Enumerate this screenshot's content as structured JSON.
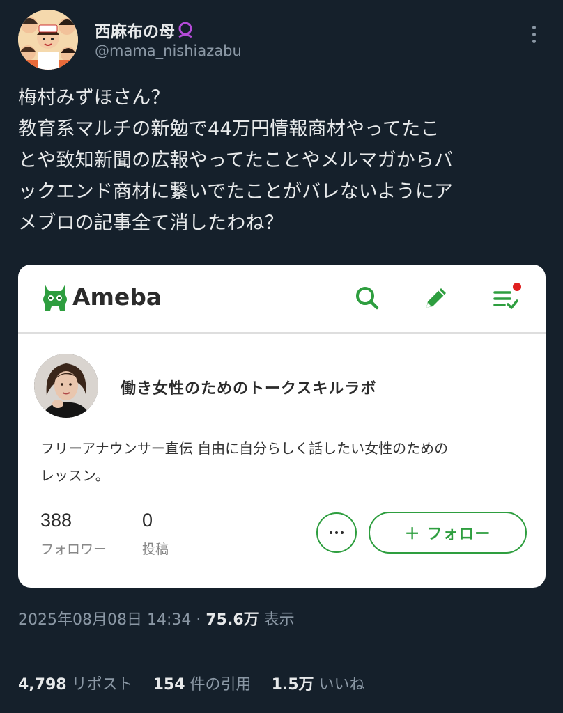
{
  "author": {
    "display_name": "西麻布の母",
    "handle": "@mama_nishiazabu",
    "badge_icon": "purple-ring-badge-icon",
    "badge_color": "#b44bd8"
  },
  "tweet": {
    "lines": [
      "梅村みずほさん？",
      "教育系マルチの新勉で44万円情報商材やってたこ",
      "とや致知新聞の広報やってたことやメルマガからバ",
      "ックエンド商材に繋いでたことがバレないようにア",
      "メブロの記事全て消したわね？"
    ]
  },
  "card": {
    "brand": "Ameba",
    "brand_color": "#2e9e3f",
    "header_icons": [
      "search-icon",
      "pencil-icon",
      "notification-list-icon"
    ],
    "blog_title": "働き女性のためのトークスキルラボ",
    "description_lines": [
      "フリーアナウンサー直伝 自由に自分らしく話したい女性のための",
      "レッスン。"
    ],
    "followers_count": "388",
    "followers_label": "フォロワー",
    "posts_count": "0",
    "posts_label": "投稿",
    "more_button_icon": "ellipsis-icon",
    "follow_label": "＋ フォロー"
  },
  "meta": {
    "timestamp": "2025年08月08日 14:34",
    "separator": "·",
    "views": "75.6万",
    "views_label": "表示"
  },
  "stats": {
    "reposts": "4,798",
    "reposts_label": "リポスト",
    "quotes": "154",
    "quotes_label": "件の引用",
    "likes": "1.5万",
    "likes_label": "いいね"
  }
}
